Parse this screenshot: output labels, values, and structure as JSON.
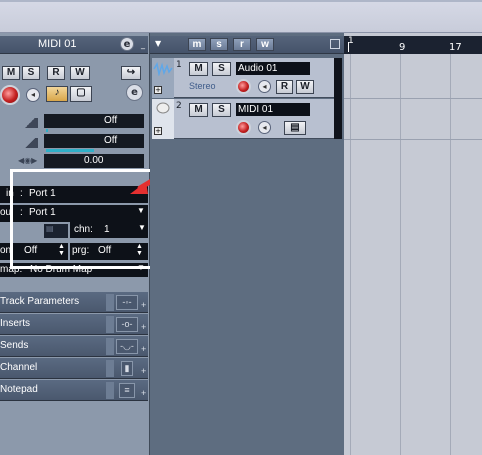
{
  "inspector": {
    "title": "MIDI 01",
    "edit_icon": "e",
    "mute": "M",
    "solo": "S",
    "read": "R",
    "write": "W",
    "fields": {
      "volume": "Off",
      "pan": "Off",
      "delay": "0.00"
    },
    "in_label": "in",
    "in_value": "Port 1",
    "out_label": "ou",
    "out_value": "Port 1",
    "channel_label": "chn:",
    "channel_value": "1",
    "bank_label": "on:",
    "bank_value": "Off",
    "program_label": "prg:",
    "program_value": "Off",
    "map_label": "map:",
    "map_value": "No Drum Map",
    "sections": [
      "Track Parameters",
      "Inserts",
      "Sends",
      "Channel",
      "Notepad"
    ]
  },
  "tracklist": {
    "header_buttons": [
      "m",
      "s",
      "r",
      "w"
    ],
    "tracks": [
      {
        "num": "1",
        "name": "Audio 01",
        "type": "Stereo"
      },
      {
        "num": "2",
        "name": "MIDI 01"
      }
    ]
  },
  "ruler": {
    "marks": [
      "1",
      "9",
      "17"
    ]
  },
  "colors": {
    "accent_red": "#e53030",
    "track_bg": "#b8c0d0",
    "inspector_bg": "#8c99ab"
  }
}
